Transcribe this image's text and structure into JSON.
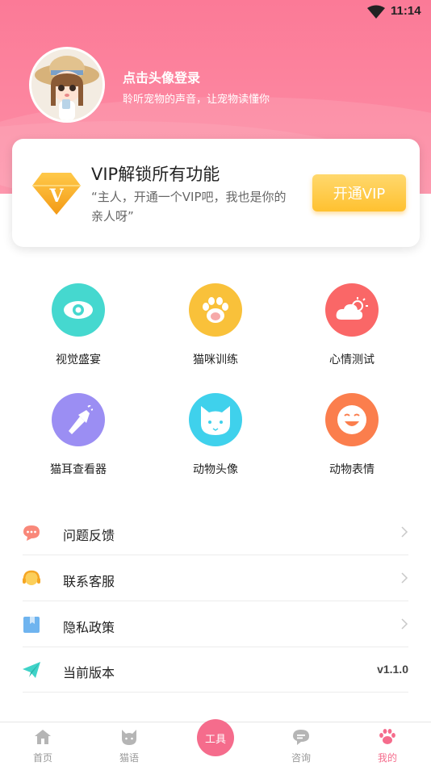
{
  "status_bar": {
    "time": "11:14"
  },
  "profile": {
    "login_title": "点击头像登录",
    "login_subtitle": "聆听宠物的声音，让宠物读懂你"
  },
  "vip": {
    "title": "VIP解锁所有功能",
    "description": "“主人，开通一个VIP吧，我也是你的亲人呀”",
    "badge_letter": "V",
    "button_label": "开通VIP"
  },
  "tools": [
    {
      "label": "视觉盛宴",
      "icon": "eye-icon",
      "color": "#45d8cf"
    },
    {
      "label": "猫咪训练",
      "icon": "paw-icon",
      "color": "#f9c13a"
    },
    {
      "label": "心情测试",
      "icon": "cloud-sun-icon",
      "color": "#fa6767"
    },
    {
      "label": "猫耳查看器",
      "icon": "flashlight-icon",
      "color": "#9b8ef3"
    },
    {
      "label": "动物头像",
      "icon": "cat-face-icon",
      "color": "#3fd1ec"
    },
    {
      "label": "动物表情",
      "icon": "smile-icon",
      "color": "#fb7e4d"
    }
  ],
  "menu": [
    {
      "label": "问题反馈",
      "icon": "chat-bubble-icon"
    },
    {
      "label": "联系客服",
      "icon": "headset-icon"
    },
    {
      "label": "隐私政策",
      "icon": "bookmark-icon"
    },
    {
      "label": "当前版本",
      "icon": "paper-plane-icon",
      "value": "v1.1.0"
    }
  ],
  "tabbar": {
    "tabs": [
      {
        "label": "首页",
        "icon": "home-icon"
      },
      {
        "label": "猫语",
        "icon": "cat-icon"
      },
      {
        "label": "工具",
        "icon": "tools-icon"
      },
      {
        "label": "咨询",
        "icon": "message-icon"
      },
      {
        "label": "我的",
        "icon": "paw-icon"
      }
    ],
    "center_label": "工具",
    "active_index": 4,
    "active_color": "#f56c8c"
  },
  "colors": {
    "header": "#fb7a97",
    "accent": "#f56c8c",
    "vip_button": "#ffc130"
  }
}
